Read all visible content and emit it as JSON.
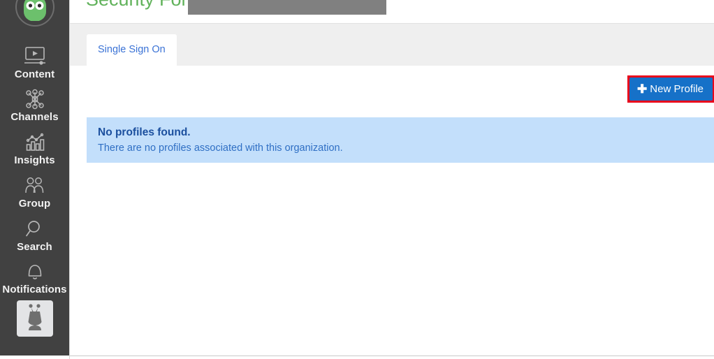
{
  "sidebar": {
    "avatar_icon": "green-android-avatar",
    "items": [
      {
        "label": "Content",
        "icon": "video-monitor-icon"
      },
      {
        "label": "Channels",
        "icon": "network-nodes-icon"
      },
      {
        "label": "Insights",
        "icon": "bar-chart-trend-icon"
      },
      {
        "label": "Group",
        "icon": "people-group-icon"
      },
      {
        "label": "Search",
        "icon": "magnifier-icon"
      },
      {
        "label": "Notifications",
        "icon": "bell-icon"
      }
    ],
    "bottom_tile_icon": "robot-avatar-icon"
  },
  "header": {
    "title": "Security For:",
    "title_color": "#61b25b",
    "redacted_value": "",
    "redaction_color": "#808080"
  },
  "tabs": [
    {
      "label": "Single Sign On",
      "active": true
    }
  ],
  "toolbar": {
    "new_profile_label": "New Profile",
    "new_profile_icon": "plus-icon",
    "button_color": "#1671c8",
    "highlight_color": "#e8071c"
  },
  "alert": {
    "title": "No profiles found.",
    "body": "There are no profiles associated with this organization.",
    "background_color": "#c3dffb",
    "title_color": "#1b4f9e",
    "body_color": "#2f6fc4"
  }
}
